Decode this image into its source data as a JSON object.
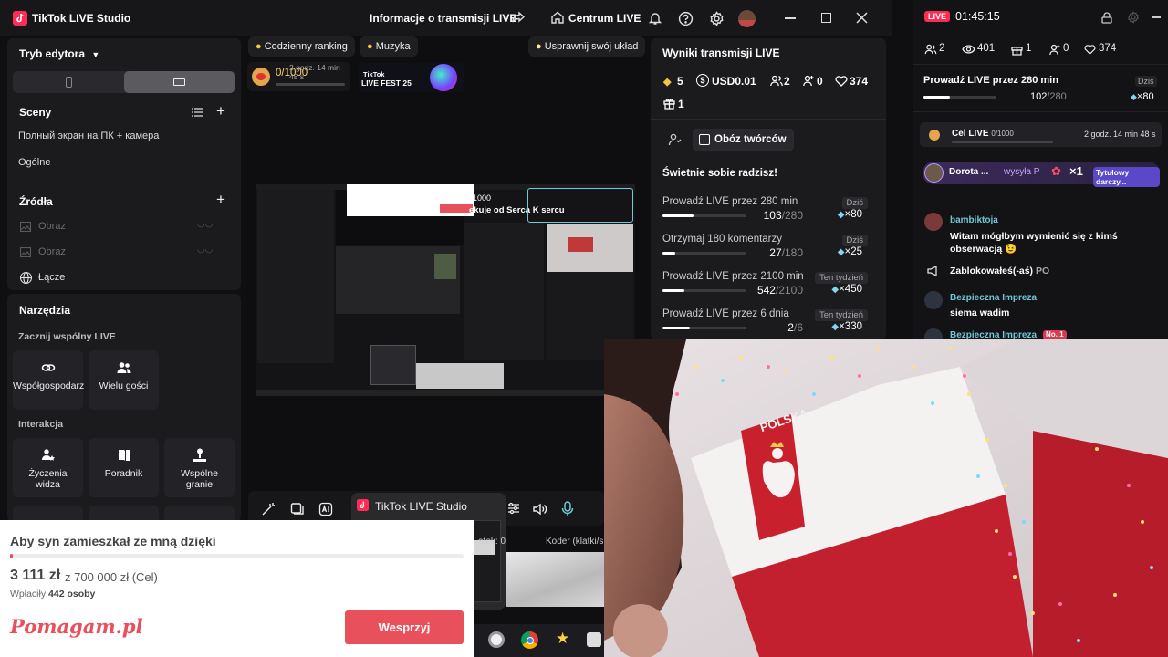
{
  "titlebar": {
    "app_name": "TikTok LIVE Studio",
    "center_title": "Informacje o transmisji LIVE",
    "home_label": "Centrum LIVE"
  },
  "editor": {
    "mode_label": "Tryb edytora",
    "scenes_title": "Sceny",
    "scenes": [
      "Полный экран на ПК + камера",
      "Ogólne"
    ],
    "sources_title": "Źródła",
    "sources": [
      "Obraz",
      "Obraz",
      "Łącze"
    ],
    "tools_title": "Narzędzia",
    "collab_title": "Zacznij wspólny LIVE",
    "collab_tiles": [
      "Współgospodarz",
      "Wielu gości"
    ],
    "interaction_title": "Interakcja",
    "interaction_tiles": [
      "Życzenia widza",
      "Poradnik",
      "Wspólne granie"
    ]
  },
  "preview": {
    "pill_ranking": "Codzienny ranking",
    "pill_music": "Muzyka",
    "pill_layout": "Usprawnij swój układ",
    "goal_progress": "0/1000",
    "goal_timer": "2 godz. 14 min 48 s",
    "fest_label_1": "TikTok",
    "fest_label_2": "LIVE FEST 25",
    "overlay_counter": "1000",
    "overlay_text": "ekuje od Serca K sercu",
    "status_partial_1": "atek: 0",
    "status_partial_2": "Koder (klatki/s"
  },
  "popup": {
    "title": "TikTok LIVE Studio"
  },
  "stats": {
    "title": "Wyniki transmisji LIVE",
    "diamonds": "5",
    "usd": "USD0.01",
    "viewers": "2",
    "new_followers": "0",
    "likes": "374",
    "gifts": "1",
    "camp_button": "Obóz twórców",
    "praise": "Świetnie sobie radzisz!",
    "tasks": [
      {
        "title": "Prowadź LIVE przez 280 min",
        "tag": "Dziś",
        "done": "103",
        "total": "/280",
        "reward": "×80",
        "fraction": 0.37
      },
      {
        "title": "Otrzymaj 180 komentarzy",
        "tag": "Dziś",
        "done": "27",
        "total": "/180",
        "reward": "×25",
        "fraction": 0.15
      },
      {
        "title": "Prowadź LIVE przez 2100 min",
        "tag": "Ten tydzień",
        "done": "542",
        "total": "/2100",
        "reward": "×450",
        "fraction": 0.26
      },
      {
        "title": "Prowadź LIVE przez 6 dnia",
        "tag": "Ten tydzień",
        "done": "2",
        "total": "/6",
        "reward": "×330",
        "fraction": 0.33
      }
    ]
  },
  "live_panel": {
    "badge": "LIVE",
    "timer": "01:45:15",
    "viewers": "2",
    "views": "401",
    "gifts": "1",
    "followers": "0",
    "likes": "374",
    "task_title": "Prowadź LIVE przez 280 min",
    "task_tag": "Dziś",
    "task_done": "102",
    "task_total": "/280",
    "task_reward": "×80",
    "task_fraction": 0.36,
    "goal_label": "Cel LIVE",
    "goal_value": "0/1000",
    "goal_timer": "2 godz. 14 min 48 s",
    "gift_name": "Dorota ...",
    "gift_action": "wysyła P",
    "gift_count": "×1",
    "gift_badge": "Tytułowy darczy...",
    "chat": [
      {
        "name": "bambiktoja_",
        "text": "Witam mógłbym wymienić się z kimś obserwacją 😉"
      },
      {
        "name": "",
        "text": "Zablokowałeś(-aś)",
        "suffix": "PO"
      },
      {
        "name": "Bezpieczna Impreza",
        "text": "siema wadim"
      },
      {
        "name": "Bezpieczna Impreza",
        "badge": "No. 1",
        "text": ""
      }
    ]
  },
  "webcam": {
    "flag_text": "POLSKA"
  },
  "donation": {
    "title": "Aby syn zamieszkał ze mną dzięki",
    "amount": "3 111 zł",
    "goal": "z 700 000 zł (Cel)",
    "payers_label": "Wpłaciły",
    "payers_count": "442 osoby",
    "brand": "Pomagam.pl",
    "button": "Wesprzyj",
    "fraction": 0.0044
  },
  "colors": {
    "accent": "#fe2c55",
    "teal": "#6fc8d6",
    "donate_red": "#e8505b"
  }
}
